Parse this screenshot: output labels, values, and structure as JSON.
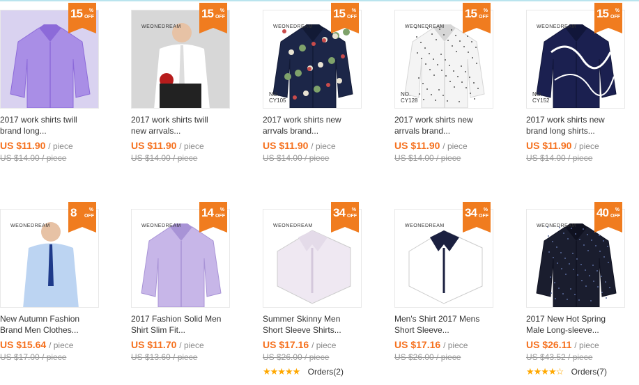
{
  "colors": {
    "accent": "#f5701d",
    "badge": "#f07c1f",
    "muted": "#999999"
  },
  "products": [
    {
      "title_line1": "2017 work shirts twill",
      "title_line2": "brand long...",
      "price": "US $11.90",
      "unit": "/ piece",
      "old_price": "US $14.00 / piece",
      "discount": "15",
      "off": "OFF",
      "brand": "",
      "code": "",
      "rating": null,
      "orders": ""
    },
    {
      "title_line1": "2017 work shirts twill",
      "title_line2": "new arrvals...",
      "price": "US $11.90",
      "unit": "/ piece",
      "old_price": "US $14.00 / piece",
      "discount": "15",
      "off": "OFF",
      "brand": "WEONEDREAM",
      "code": "",
      "rating": null,
      "orders": ""
    },
    {
      "title_line1": "2017 work shirts new",
      "title_line2": "arrvals brand...",
      "price": "US $11.90",
      "unit": "/ piece",
      "old_price": "US $14.00 / piece",
      "discount": "15",
      "off": "OFF",
      "brand": "WEONEDREAM",
      "code": "CY105",
      "code_label": "NO.",
      "rating": null,
      "orders": ""
    },
    {
      "title_line1": "2017 work shirts new",
      "title_line2": "arrvals brand...",
      "price": "US $11.90",
      "unit": "/ piece",
      "old_price": "US $14.00 / piece",
      "discount": "15",
      "off": "OFF",
      "brand": "WEONEDREAM",
      "code": "CY128",
      "code_label": "NO.",
      "rating": null,
      "orders": ""
    },
    {
      "title_line1": "2017 work shirts new",
      "title_line2": "brand long shirts...",
      "price": "US $11.90",
      "unit": "/ piece",
      "old_price": "US $14.00 / piece",
      "discount": "15",
      "off": "OFF",
      "brand": "WEONEDREAM",
      "code": "CY152",
      "code_label": "NO.",
      "rating": null,
      "orders": ""
    },
    {
      "title_line1": "New Autumn Fashion",
      "title_line2": "Brand Men Clothes...",
      "price": "US $15.64",
      "unit": "/ piece",
      "old_price": "US $17.00 / piece",
      "discount": "8",
      "off": "OFF",
      "brand": "WEONEDREAM",
      "code": "",
      "rating": null,
      "orders": ""
    },
    {
      "title_line1": "2017 Fashion Solid Men",
      "title_line2": "Shirt Slim Fit...",
      "price": "US $11.70",
      "unit": "/ piece",
      "old_price": "US $13.60 / piece",
      "discount": "14",
      "off": "OFF",
      "brand": "WEONEDREAM",
      "code": "",
      "rating": null,
      "orders": ""
    },
    {
      "title_line1": "Summer Skinny Men",
      "title_line2": "Short Sleeve Shirts...",
      "price": "US $17.16",
      "unit": "/ piece",
      "old_price": "US $26.00 / piece",
      "discount": "34",
      "off": "OFF",
      "brand": "WEONEDREAM",
      "code": "",
      "rating": 5,
      "orders": "Orders(2)"
    },
    {
      "title_line1": "Men's Shirt 2017 Mens",
      "title_line2": "Short Sleeve...",
      "price": "US $17.16",
      "unit": "/ piece",
      "old_price": "US $26.00 / piece",
      "discount": "34",
      "off": "OFF",
      "brand": "WEONEDREAM",
      "code": "",
      "rating": null,
      "orders": ""
    },
    {
      "title_line1": "2017 New Hot Spring",
      "title_line2": "Male Long-sleeve...",
      "price": "US $26.11",
      "unit": "/ piece",
      "old_price": "US $43.52 / piece",
      "discount": "40",
      "off": "OFF",
      "brand": "WEONEDREAM",
      "code": "",
      "rating": 4.5,
      "orders": "Orders(7)"
    }
  ]
}
